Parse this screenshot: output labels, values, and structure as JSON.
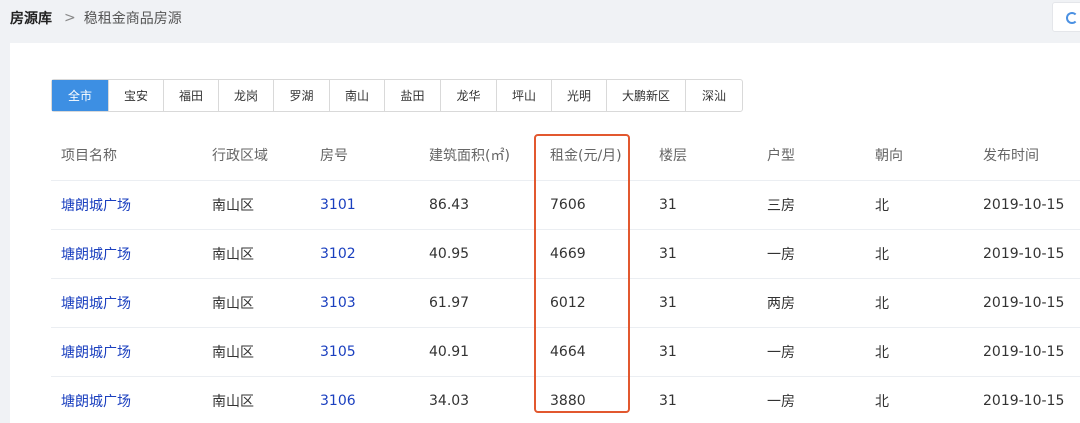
{
  "breadcrumb": {
    "root": "房源库",
    "separator": ">",
    "current": "稳租金商品房源"
  },
  "tabs": [
    {
      "label": "全市",
      "active": true
    },
    {
      "label": "宝安",
      "active": false
    },
    {
      "label": "福田",
      "active": false
    },
    {
      "label": "龙岗",
      "active": false
    },
    {
      "label": "罗湖",
      "active": false
    },
    {
      "label": "南山",
      "active": false
    },
    {
      "label": "盐田",
      "active": false
    },
    {
      "label": "龙华",
      "active": false
    },
    {
      "label": "坪山",
      "active": false
    },
    {
      "label": "光明",
      "active": false
    },
    {
      "label": "大鹏新区",
      "active": false
    },
    {
      "label": "深汕",
      "active": false
    }
  ],
  "table": {
    "headers": [
      "项目名称",
      "行政区域",
      "房号",
      "建筑面积(㎡)",
      "租金(元/月)",
      "楼层",
      "户型",
      "朝向",
      "发布时间"
    ],
    "rows": [
      [
        "塘朗城广场",
        "南山区",
        "3101",
        "86.43",
        "7606",
        "31",
        "三房",
        "北",
        "2019-10-15"
      ],
      [
        "塘朗城广场",
        "南山区",
        "3102",
        "40.95",
        "4669",
        "31",
        "一房",
        "北",
        "2019-10-15"
      ],
      [
        "塘朗城广场",
        "南山区",
        "3103",
        "61.97",
        "6012",
        "31",
        "两房",
        "北",
        "2019-10-15"
      ],
      [
        "塘朗城广场",
        "南山区",
        "3105",
        "40.91",
        "4664",
        "31",
        "一房",
        "北",
        "2019-10-15"
      ],
      [
        "塘朗城广场",
        "南山区",
        "3106",
        "34.03",
        "3880",
        "31",
        "一房",
        "北",
        "2019-10-15"
      ]
    ]
  },
  "colors": {
    "accent": "#3d8fe3",
    "link": "#1a3fbf",
    "highlight": "#e2582f"
  },
  "icons": {
    "separator": "chevron-right-icon",
    "loader": "loading-spinner-icon"
  }
}
